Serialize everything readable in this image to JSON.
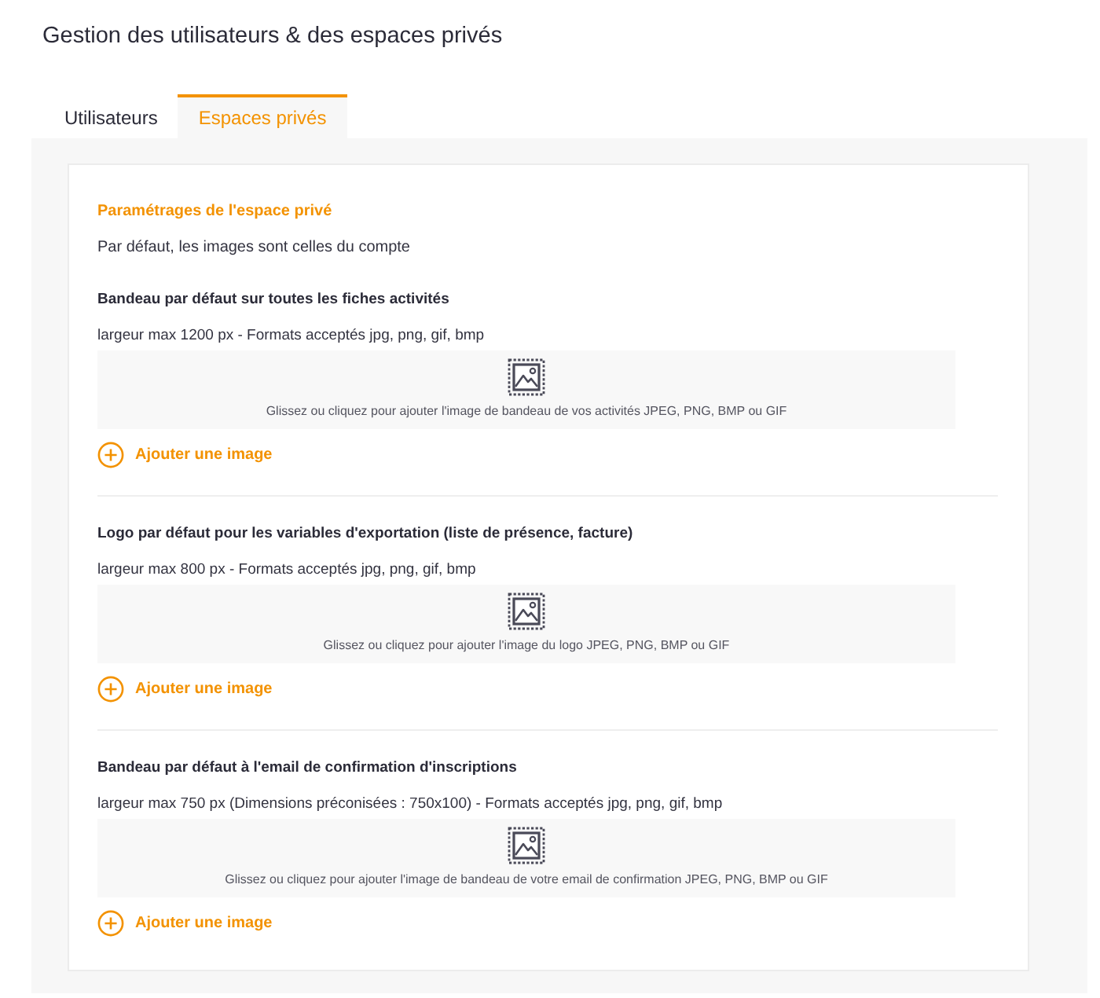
{
  "page": {
    "title": "Gestion des utilisateurs & des espaces privés"
  },
  "tabs": [
    {
      "label": "Utilisateurs",
      "selected": false
    },
    {
      "label": "Espaces privés",
      "selected": true
    }
  ],
  "settings": {
    "heading": "Paramétrages de l'espace privé",
    "note": "Par défaut, les images sont celles du compte",
    "sections": [
      {
        "title": "Bandeau par défaut sur toutes les fiches activités",
        "spec": "largeur max 1200 px - Formats acceptés jpg, png, gif, bmp",
        "dropzone_text": "Glissez ou cliquez pour ajouter l'image de bandeau de vos activités JPEG, PNG, BMP ou GIF",
        "add_button": "Ajouter une image"
      },
      {
        "title": "Logo par défaut pour les variables d'exportation (liste de présence, facture)",
        "spec": "largeur max 800 px - Formats acceptés jpg, png, gif, bmp",
        "dropzone_text": "Glissez ou cliquez pour ajouter l'image du logo JPEG, PNG, BMP ou GIF",
        "add_button": "Ajouter une image"
      },
      {
        "title": "Bandeau par défaut à l'email de confirmation d'inscriptions",
        "spec": "largeur max 750 px (Dimensions préconisées : 750x100) - Formats acceptés jpg, png, gif, bmp",
        "dropzone_text": "Glissez ou cliquez pour ajouter l'image de bandeau de votre email de confirmation JPEG, PNG, BMP ou GIF",
        "add_button": "Ajouter une image"
      }
    ]
  }
}
